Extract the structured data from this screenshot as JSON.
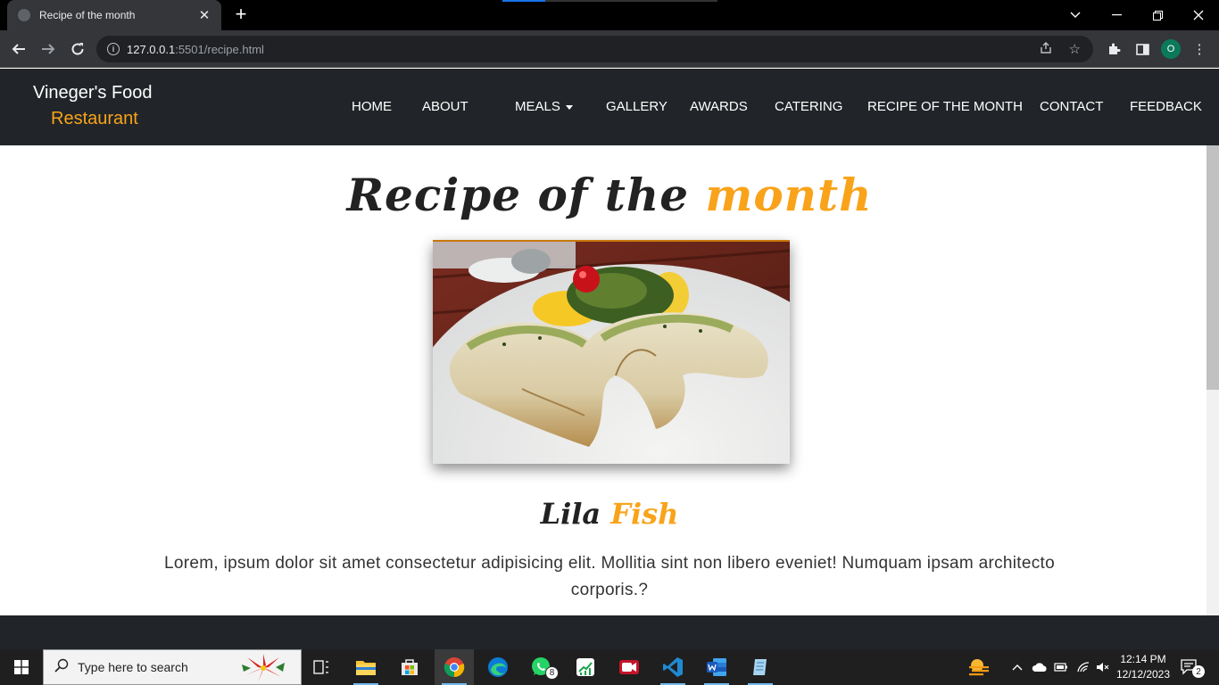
{
  "browser": {
    "tab_title": "Recipe of the month",
    "url_host": "127.0.0.1",
    "url_path": ":5501/recipe.html",
    "profile_initial": "O"
  },
  "site": {
    "brand_line1": "Vineger's Food",
    "brand_line2": "Restaurant",
    "nav": [
      "HOME",
      "ABOUT",
      "MEALS",
      "GALLERY",
      "AWARDS",
      "CATERING",
      "RECIPE OF THE MONTH",
      "CONTACT",
      "FEEDBACK"
    ]
  },
  "page": {
    "title_main": "Recipe of the ",
    "title_accent": "month",
    "dish_main": "Lila ",
    "dish_accent": "Fish",
    "description": "Lorem, ipsum dolor sit amet consectetur adipisicing elit. Mollitia sint non libero eveniet! Numquam ipsam architecto corporis.?"
  },
  "taskbar": {
    "search_placeholder": "Type here to search",
    "whatsapp_badge": "8",
    "time": "12:14 PM",
    "date": "12/12/2023",
    "notification_count": "2"
  },
  "colors": {
    "accent": "#f9a31a",
    "header_bg": "#212529",
    "chrome_bg": "#35363a"
  }
}
